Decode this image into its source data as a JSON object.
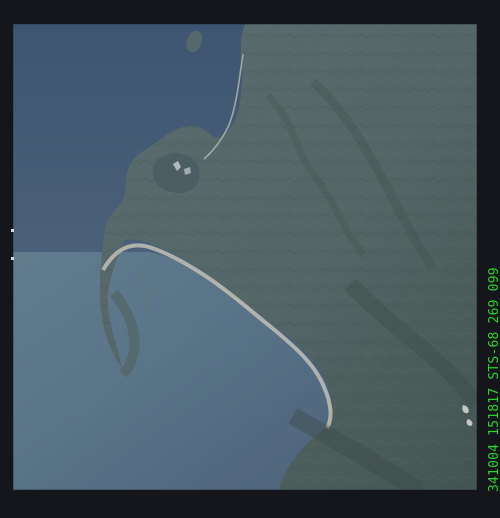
{
  "image": {
    "caption": "STS-68",
    "frame_label": "341004 151817   STS-68   269  099",
    "colors": {
      "border": "#15161b",
      "ocean": "#4b6078",
      "land": "#586a6d",
      "beach": "#c9c7b8",
      "caption_text": "#2bd12c"
    },
    "icons": {
      "frame": "photo-frame-icon"
    }
  }
}
